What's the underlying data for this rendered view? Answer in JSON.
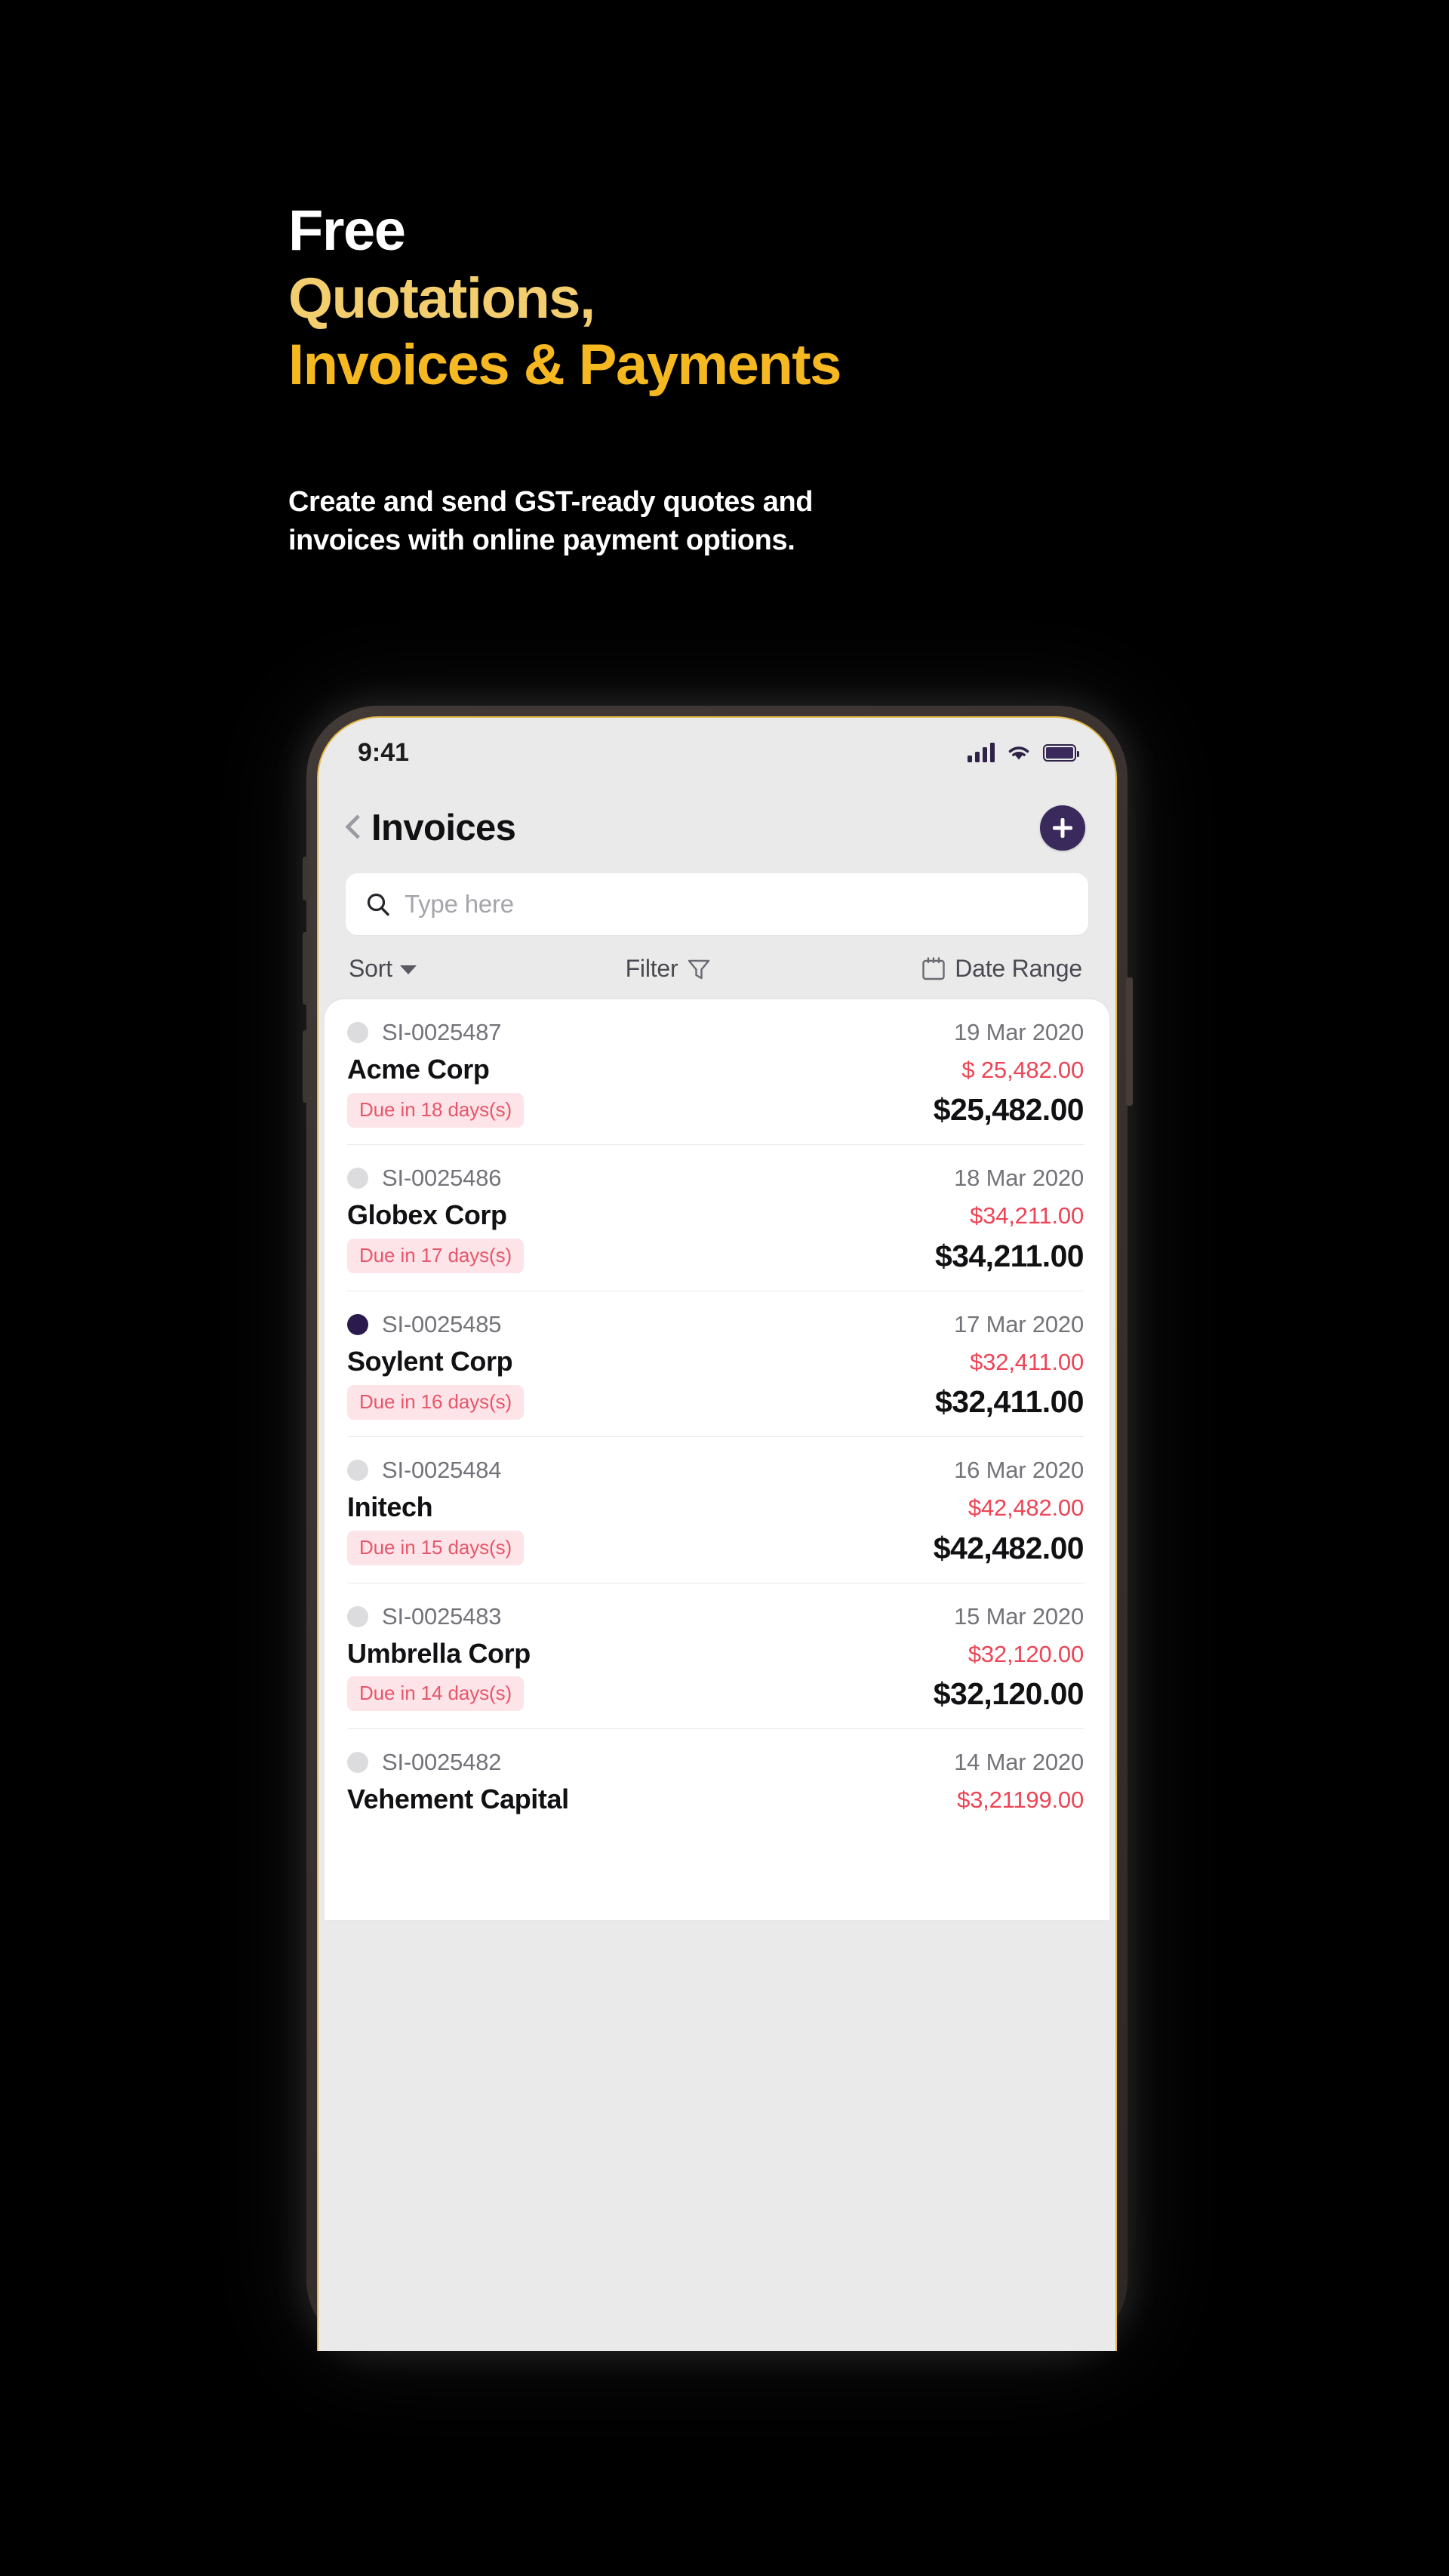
{
  "promo": {
    "headline_line1": "Free",
    "headline_line2": "Quotations,",
    "headline_line3": "Invoices & Payments",
    "subhead_line1": "Create and send GST-ready quotes and",
    "subhead_line2": "invoices with online payment options.",
    "colors": {
      "white": "#FFFFFF",
      "gold_light": "#F2CE6E",
      "gold_strong": "#F5B820",
      "background": "#000000"
    }
  },
  "phone": {
    "status_bar": {
      "time": "9:41",
      "signal_icon": "cellular-signal-icon",
      "wifi_icon": "wifi-icon",
      "battery_icon": "battery-icon"
    },
    "navbar": {
      "back_icon": "chevron-left-icon",
      "title": "Invoices",
      "add_icon": "plus-icon"
    },
    "search": {
      "icon": "search-icon",
      "placeholder": "Type here",
      "value": ""
    },
    "toolbar": {
      "sort_label": "Sort",
      "sort_icon": "chevron-down-icon",
      "filter_label": "Filter",
      "filter_icon": "funnel-icon",
      "date_range_label": "Date Range",
      "date_range_icon": "calendar-icon"
    },
    "accent_colors": {
      "primary_purple": "#3A2A5C",
      "active_dot": "#2B1B4D",
      "amount_red": "#EE4455",
      "badge_bg": "#FCE4E8",
      "badge_text": "#E8566B",
      "screen_bg": "#EAEAEA",
      "card_bg": "#FFFFFF",
      "frame": "#3A322E",
      "bezel_gold": "#E2B02C"
    },
    "invoices": [
      {
        "id": "SI-0025487",
        "date": "19 Mar 2020",
        "customer": "Acme Corp",
        "due_amount": "$ 25,482.00",
        "status_label": "Due in 18 days(s)",
        "total": "$25,482.00",
        "selected": false
      },
      {
        "id": "SI-0025486",
        "date": "18 Mar 2020",
        "customer": "Globex Corp",
        "due_amount": "$34,211.00",
        "status_label": "Due in 17 days(s)",
        "total": "$34,211.00",
        "selected": false
      },
      {
        "id": "SI-0025485",
        "date": "17 Mar 2020",
        "customer": "Soylent Corp",
        "due_amount": "$32,411.00",
        "status_label": "Due in 16 days(s)",
        "total": "$32,411.00",
        "selected": true
      },
      {
        "id": "SI-0025484",
        "date": "16 Mar 2020",
        "customer": "Initech",
        "due_amount": "$42,482.00",
        "status_label": "Due in 15 days(s)",
        "total": "$42,482.00",
        "selected": false
      },
      {
        "id": "SI-0025483",
        "date": "15 Mar 2020",
        "customer": "Umbrella Corp",
        "due_amount": "$32,120.00",
        "status_label": "Due in 14 days(s)",
        "total": "$32,120.00",
        "selected": false
      },
      {
        "id": "SI-0025482",
        "date": "14 Mar 2020",
        "customer": "Vehement Capital",
        "due_amount": "$3,21199.00",
        "status_label": "",
        "total": "",
        "selected": false
      }
    ]
  }
}
